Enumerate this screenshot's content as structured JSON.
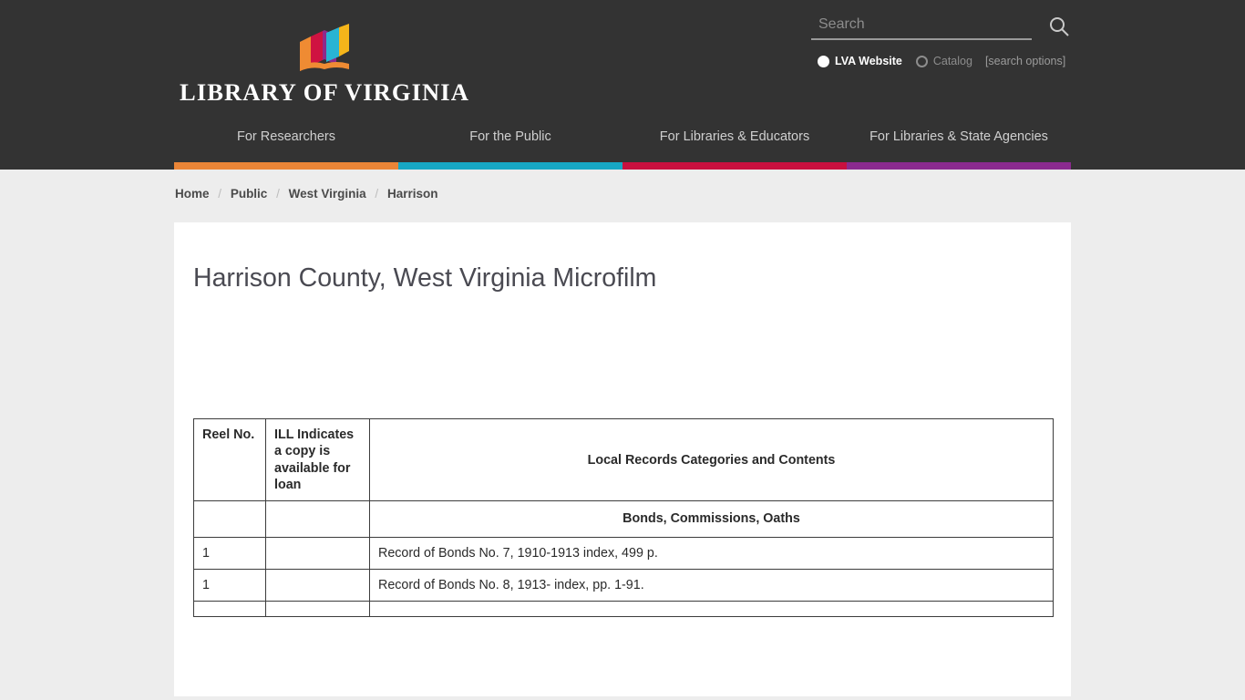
{
  "header": {
    "logo_text": "LIBRARY OF VIRGINIA",
    "logo_icon": "open-book-logo",
    "logo_colors": {
      "orange": "#ef8b33",
      "crimson": "#cf1341",
      "purple": "#8e2a8b",
      "cyan": "#29b4d4",
      "yellow": "#f5b51a"
    },
    "search": {
      "placeholder": "Search",
      "value": "",
      "icon": "search-icon",
      "options": [
        {
          "label": "LVA Website",
          "selected": true
        },
        {
          "label": "Catalog",
          "selected": false
        }
      ],
      "options_link": "[search options]"
    },
    "nav": [
      {
        "label": "For Researchers",
        "bar_color": "#ea8537"
      },
      {
        "label": "For the Public",
        "bar_color": "#17a7c4"
      },
      {
        "label": "For Libraries & Educators",
        "bar_color": "#c9103f"
      },
      {
        "label": "For Libraries & State Agencies",
        "bar_color": "#8b2a8f"
      }
    ]
  },
  "breadcrumb": {
    "items": [
      {
        "label": "Home"
      },
      {
        "label": "Public"
      },
      {
        "label": "West Virginia"
      },
      {
        "label": "Harrison"
      }
    ],
    "separator": "/"
  },
  "main": {
    "page_title": "Harrison County, West Virginia Microfilm",
    "table": {
      "headers": {
        "reel": "Reel No.",
        "ill": "ILL Indicates a copy is available for loan",
        "contents": "Local Records Categories and Contents"
      },
      "rows": [
        {
          "type": "section",
          "contents": "Bonds, Commissions, Oaths"
        },
        {
          "type": "data",
          "reel": "1",
          "ill": "",
          "contents": "Record of Bonds No. 7, 1910-1913 index, 499 p."
        },
        {
          "type": "data",
          "reel": "1",
          "ill": "",
          "contents": "Record of Bonds No. 8, 1913- index, pp. 1-91."
        },
        {
          "type": "data",
          "reel": "",
          "ill": "",
          "contents": ""
        }
      ]
    }
  }
}
